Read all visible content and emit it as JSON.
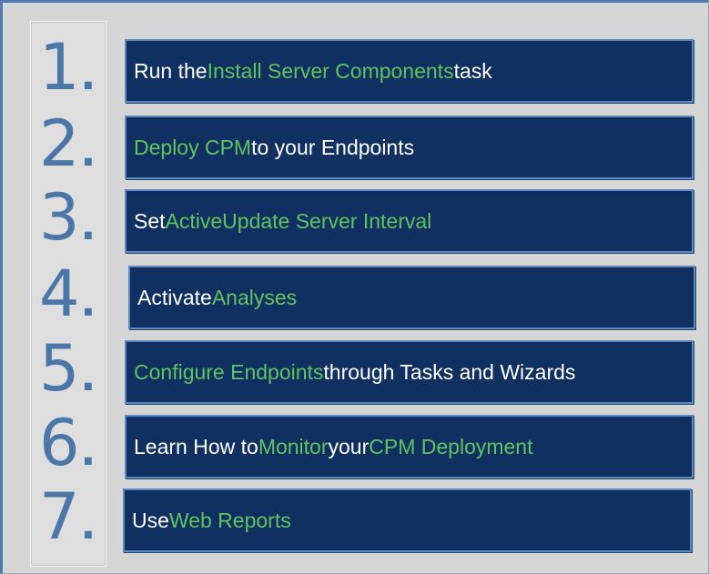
{
  "steps": [
    {
      "number": "1",
      "dot": ".",
      "parts": [
        {
          "text": "Run the ",
          "highlight": false
        },
        {
          "text": "Install Server Components",
          "highlight": true
        },
        {
          "text": " task",
          "highlight": false
        }
      ]
    },
    {
      "number": "2",
      "dot": ".",
      "parts": [
        {
          "text": "Deploy CPM",
          "highlight": true
        },
        {
          "text": " to your Endpoints",
          "highlight": false
        }
      ]
    },
    {
      "number": "3",
      "dot": ".",
      "parts": [
        {
          "text": "Set ",
          "highlight": false
        },
        {
          "text": "ActiveUpdate Server Interval",
          "highlight": true
        }
      ]
    },
    {
      "number": "4",
      "dot": ".",
      "parts": [
        {
          "text": "Activate ",
          "highlight": false
        },
        {
          "text": "Analyses",
          "highlight": true
        }
      ]
    },
    {
      "number": "5",
      "dot": ".",
      "parts": [
        {
          "text": "Configure Endpoints",
          "highlight": true
        },
        {
          "text": " through Tasks and Wizards",
          "highlight": false
        }
      ]
    },
    {
      "number": "6",
      "dot": ".",
      "parts": [
        {
          "text": "Learn How to ",
          "highlight": false
        },
        {
          "text": "Monitor",
          "highlight": true
        },
        {
          "text": " your ",
          "highlight": false
        },
        {
          "text": "CPM Deployment",
          "highlight": true
        }
      ]
    },
    {
      "number": "7",
      "dot": ".",
      "parts": [
        {
          "text": "Use ",
          "highlight": false
        },
        {
          "text": "Web Reports",
          "highlight": true
        }
      ]
    }
  ],
  "colors": {
    "box_fill": "#0f3060",
    "box_border": "#5d88bd",
    "highlight_text": "#5fc35f",
    "plain_text": "#ffffff",
    "number_color": "#4b77a8",
    "background": "#d6d6d6"
  }
}
